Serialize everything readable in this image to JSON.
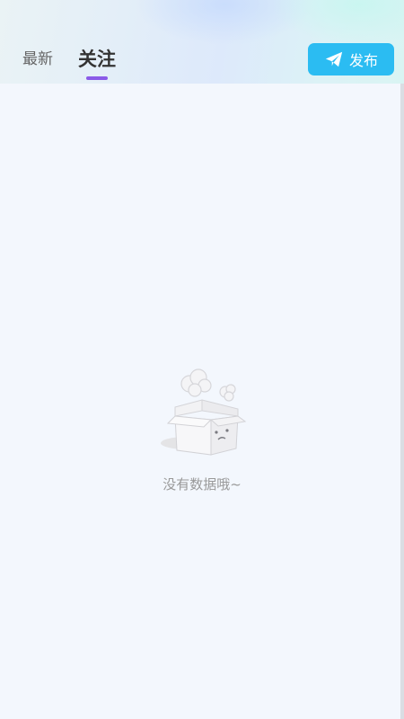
{
  "tabs": [
    {
      "label": "最新",
      "active": false
    },
    {
      "label": "关注",
      "active": true
    }
  ],
  "publish": {
    "label": "发布",
    "icon": "paper-plane-icon"
  },
  "empty_state": {
    "icon": "empty-box-icon",
    "message": "没有数据哦~"
  },
  "colors": {
    "accent": "#2bbcf2",
    "tab_indicator": "#8a5ae8",
    "background": "#f3f7fd"
  }
}
